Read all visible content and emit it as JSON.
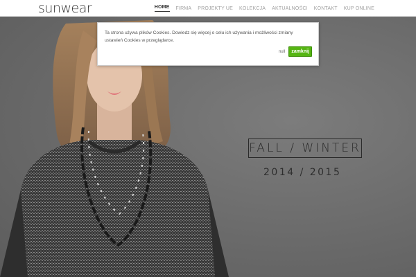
{
  "header": {
    "logo": "sunwear",
    "nav": [
      "HOME",
      "FIRMA",
      "PROJEKTY UE",
      "KOLEKCJA",
      "AKTUALNOŚCI",
      "KONTAKT",
      "KUP ONLINE"
    ]
  },
  "hero": {
    "season": "FALL / WINTER",
    "years": "2014 / 2015"
  },
  "cookie": {
    "message": "Ta strona używa plików Cookies. Dowiedz się więcej o celu ich używania i możliwości zmiany ustawień Cookies w przeglądarce.",
    "link": "null",
    "button": "zamknij"
  },
  "colors": {
    "accept_button": "#55b512",
    "background": "#6b6b6b"
  }
}
